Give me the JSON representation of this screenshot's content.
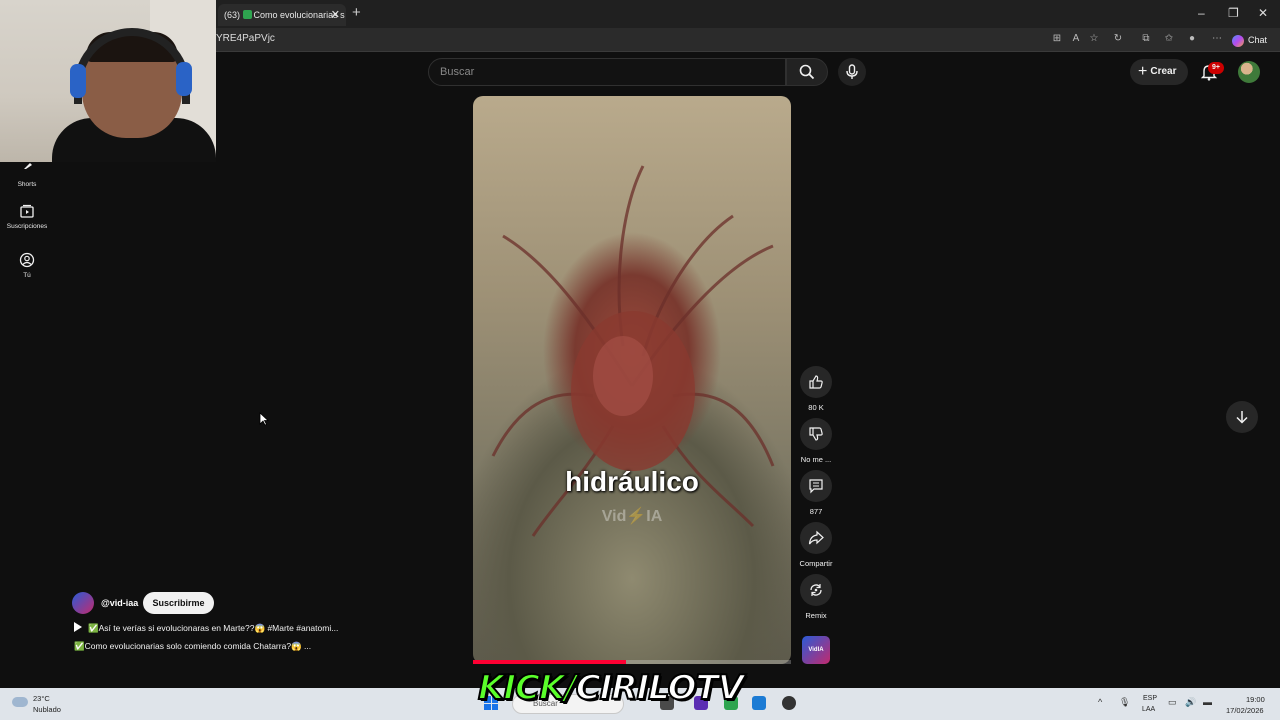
{
  "browser": {
    "tab": {
      "count": "(63)",
      "title": "Como evolucionarias s"
    },
    "new_tab": "+",
    "url_fragment": "YRE4PaPVjc",
    "chat_label": "Chat",
    "window_controls": [
      "minimize-icon",
      "restore-icon",
      "close-icon"
    ]
  },
  "youtube_header": {
    "search_placeholder": "Buscar",
    "create_label": "Crear",
    "notification_count": "9+"
  },
  "sidebar": {
    "items": [
      {
        "label": "Shorts",
        "icon": "shorts-icon"
      },
      {
        "label": "Suscripciones",
        "icon": "subscriptions-icon"
      },
      {
        "label": "Tú",
        "icon": "you-icon"
      }
    ]
  },
  "video": {
    "caption": "hidráulico",
    "watermark": "Vid⚡IA",
    "progress": 0.48
  },
  "actions": {
    "likes": "80 K",
    "dislike_label": "No me ...",
    "comments": "877",
    "share_label": "Compartir",
    "remix_label": "Remix",
    "channel_thumb_text": "VidIA"
  },
  "channel": {
    "handle": "@vid-iaa",
    "subscribe_label": "Suscribirme",
    "playlist_title": "✅Así te verías si evolucionaras en Marte??😱  #Marte #anatomi...",
    "video_title": "✅Como evolucionarias solo comiendo comida Chatarra?😱 ..."
  },
  "overlay": {
    "kick_text": "KICK",
    "separator": "/",
    "channel_text": "CIRILOTV"
  },
  "taskbar": {
    "weather_temp": "23°C",
    "weather_condition": "Nublado",
    "search_placeholder": "Buscar",
    "lang_line1": "ESP",
    "lang_line2": "LAA",
    "time": "19:00",
    "date": "17/02/2026"
  },
  "colors": {
    "background": "#0f0f0f",
    "accent_red": "#ff0033",
    "kick_green": "#5aff2a",
    "taskbar": "#dfe4ea"
  }
}
